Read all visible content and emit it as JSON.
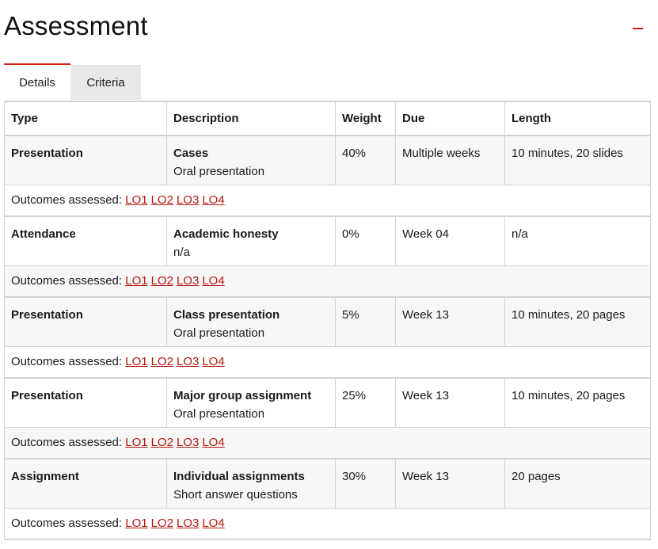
{
  "title": "Assessment",
  "tabs": [
    "Details",
    "Criteria"
  ],
  "columns": [
    "Type",
    "Description",
    "Weight",
    "Due",
    "Length"
  ],
  "outcomes_label": "Outcomes assessed:",
  "rows": [
    {
      "type": "Presentation",
      "desc_title": "Cases",
      "desc_sub": "Oral presentation",
      "weight": "40%",
      "due": "Multiple weeks",
      "length": "10 minutes, 20 slides",
      "outcomes": [
        "LO1",
        "LO2",
        "LO3",
        "LO4"
      ]
    },
    {
      "type": "Attendance",
      "desc_title": "Academic honesty",
      "desc_sub": "n/a",
      "weight": "0%",
      "due": "Week 04",
      "length": "n/a",
      "outcomes": [
        "LO1",
        "LO2",
        "LO3",
        "LO4"
      ]
    },
    {
      "type": "Presentation",
      "desc_title": "Class presentation",
      "desc_sub": "Oral presentation",
      "weight": "5%",
      "due": "Week 13",
      "length": "10 minutes, 20 pages",
      "outcomes": [
        "LO1",
        "LO2",
        "LO3",
        "LO4"
      ]
    },
    {
      "type": "Presentation",
      "desc_title": "Major group assignment",
      "desc_sub": "Oral presentation",
      "weight": "25%",
      "due": "Week 13",
      "length": "10 minutes, 20 pages",
      "outcomes": [
        "LO1",
        "LO2",
        "LO3",
        "LO4"
      ]
    },
    {
      "type": "Assignment",
      "desc_title": "Individual assignments",
      "desc_sub": "Short answer questions",
      "weight": "30%",
      "due": "Week 13",
      "length": "20 pages",
      "outcomes": [
        "LO1",
        "LO2",
        "LO3",
        "LO4"
      ]
    }
  ]
}
